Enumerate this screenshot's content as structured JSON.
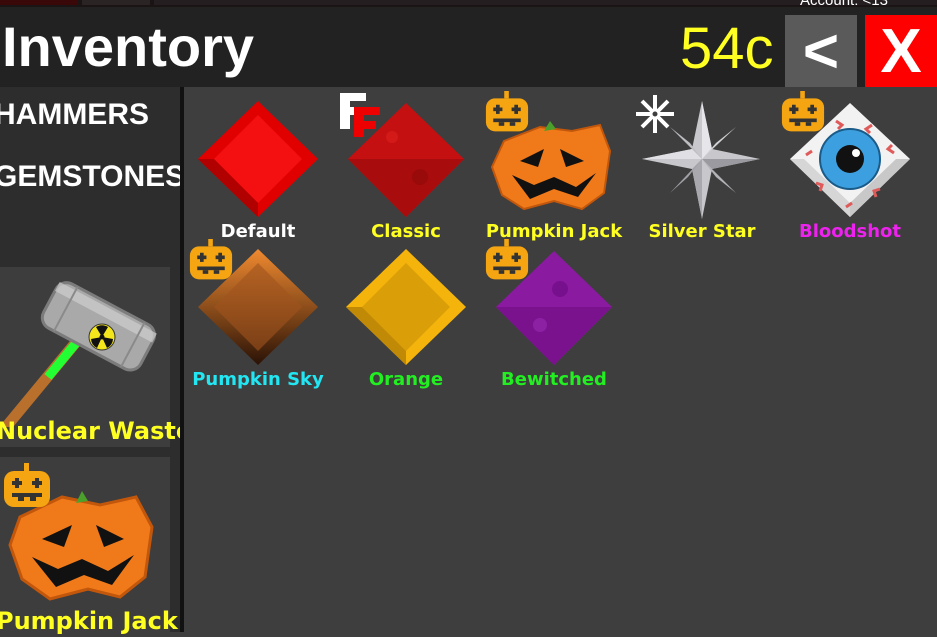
{
  "window": {
    "account_text": "Account: <13"
  },
  "header": {
    "title": "Inventory",
    "coins": "54c",
    "back_label": "<",
    "close_label": "X"
  },
  "sidebar": {
    "categories": [
      {
        "label": "HAMMERS"
      },
      {
        "label": "GEMSTONES"
      }
    ],
    "equipped": [
      {
        "type": "hammer",
        "name": "Nuclear Waste",
        "label_color": "#ffff22"
      },
      {
        "type": "gemstone",
        "name": "Pumpkin Jack",
        "label_color": "#ffff22",
        "badge": "pumpkin-icon"
      }
    ]
  },
  "colors": {
    "header_bg": "#222222",
    "sidebar_bg": "#2d2d2d",
    "grid_bg": "#3e3e3e",
    "coins": "#ffff22",
    "close_bg": "#ff0000",
    "back_bg": "#5a5a5a"
  },
  "gemstones": [
    {
      "name": "Default",
      "color": "#ffffff",
      "badge": null,
      "art": "diamond-red"
    },
    {
      "name": "Classic",
      "color": "#ffff22",
      "badge": "ff-logo-icon",
      "art": "diamond-red-textured"
    },
    {
      "name": "Pumpkin Jack",
      "color": "#ffff22",
      "badge": "pumpkin-icon",
      "art": "jack-o-lantern"
    },
    {
      "name": "Silver Star",
      "color": "#ffff22",
      "badge": "snowflake-icon",
      "art": "silver-star"
    },
    {
      "name": "Bloodshot",
      "color": "#ee22ee",
      "badge": "pumpkin-icon",
      "art": "eyeball-cube"
    },
    {
      "name": "Pumpkin Sky",
      "color": "#22e6f2",
      "badge": "pumpkin-icon",
      "art": "diamond-brown"
    },
    {
      "name": "Orange",
      "color": "#22ee22",
      "badge": null,
      "art": "diamond-gold"
    },
    {
      "name": "Bewitched",
      "color": "#22ee22",
      "badge": "pumpkin-icon",
      "art": "diamond-purple"
    }
  ]
}
